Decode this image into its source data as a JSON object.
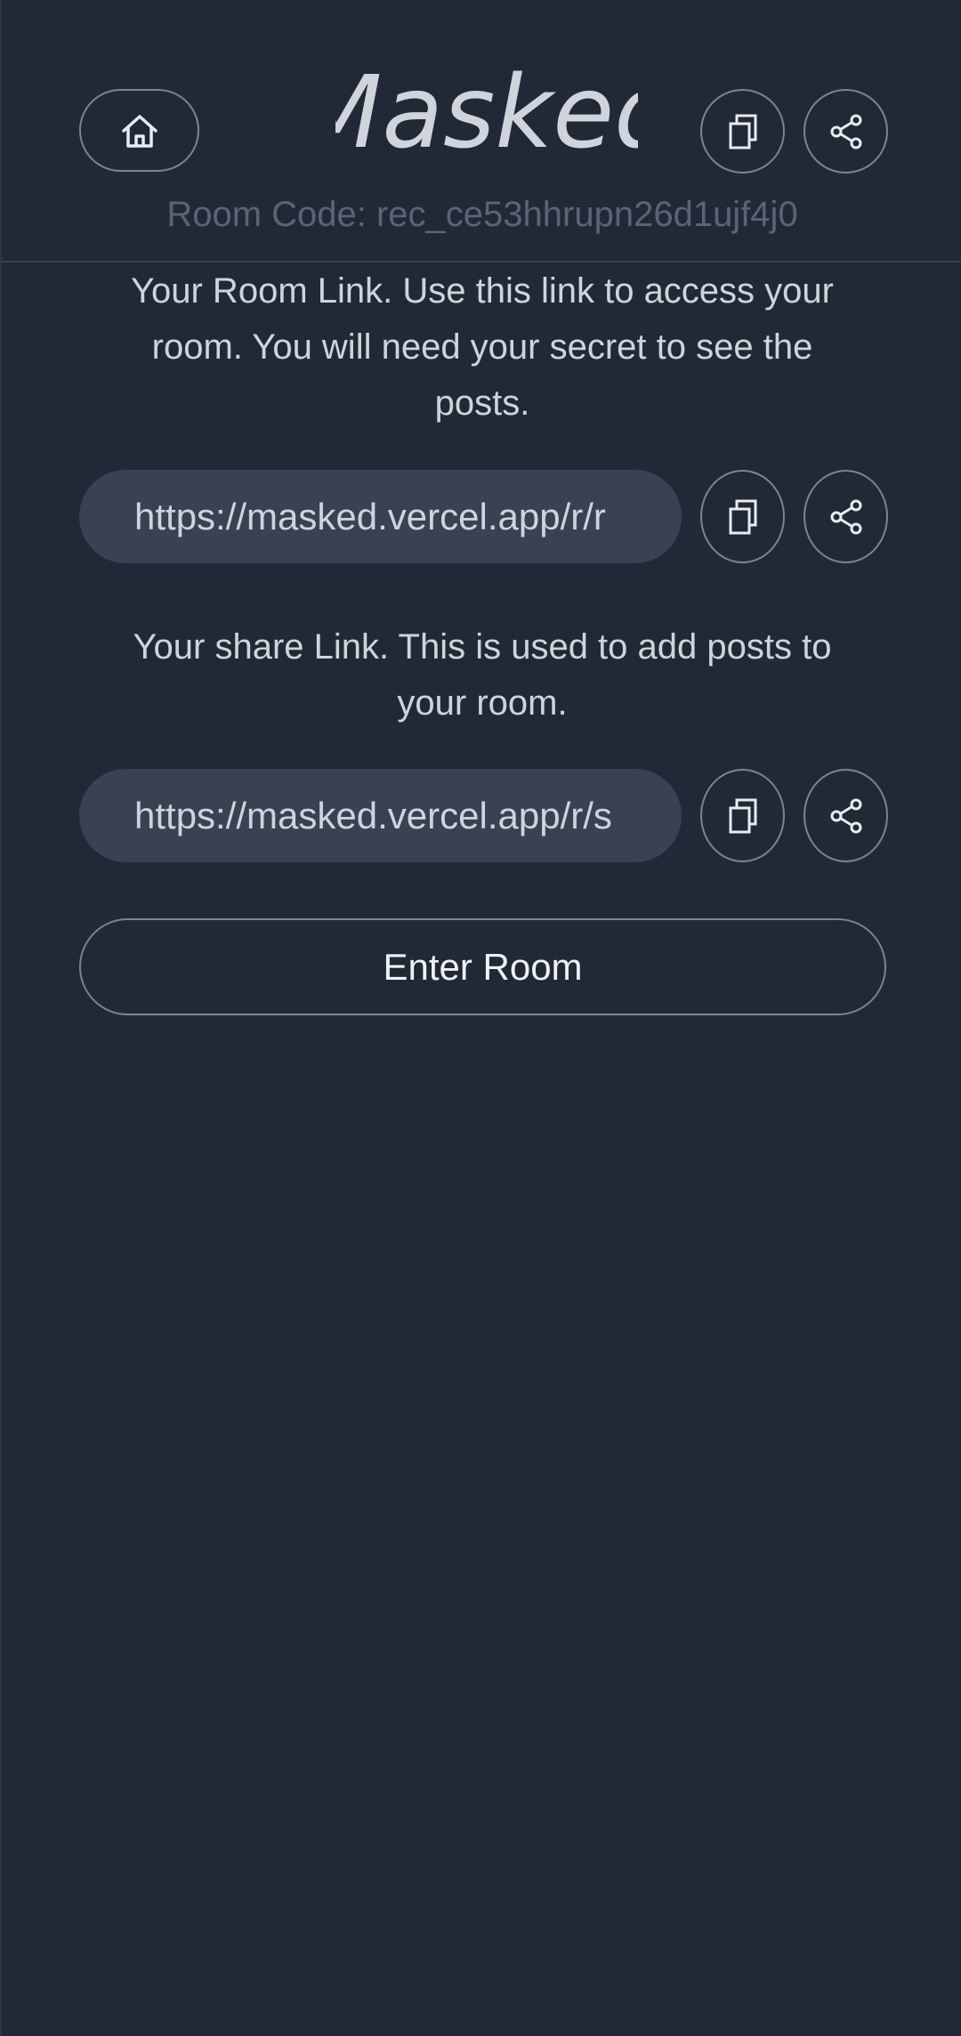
{
  "header": {
    "logo_text": "Masked",
    "room_code": "Room Code: rec_ce53hhrupn26d1ujf4j0",
    "home_icon": "home-icon",
    "copy_icon": "copy-icon",
    "share_icon": "share-icon"
  },
  "room_link": {
    "description": "Your Room Link. Use this link to access your room. You will need your secret to see the posts.",
    "value": "https://masked.vercel.app/r/r"
  },
  "share_link": {
    "description": "Your share Link. This is used to add posts to your room.",
    "value": "https://masked.vercel.app/r/s"
  },
  "actions": {
    "enter_room_label": "Enter Room"
  },
  "colors": {
    "background": "#212936",
    "field_background": "#394252",
    "border": "#7b8494",
    "text": "#cfd4db",
    "muted_text": "#5b6473"
  }
}
